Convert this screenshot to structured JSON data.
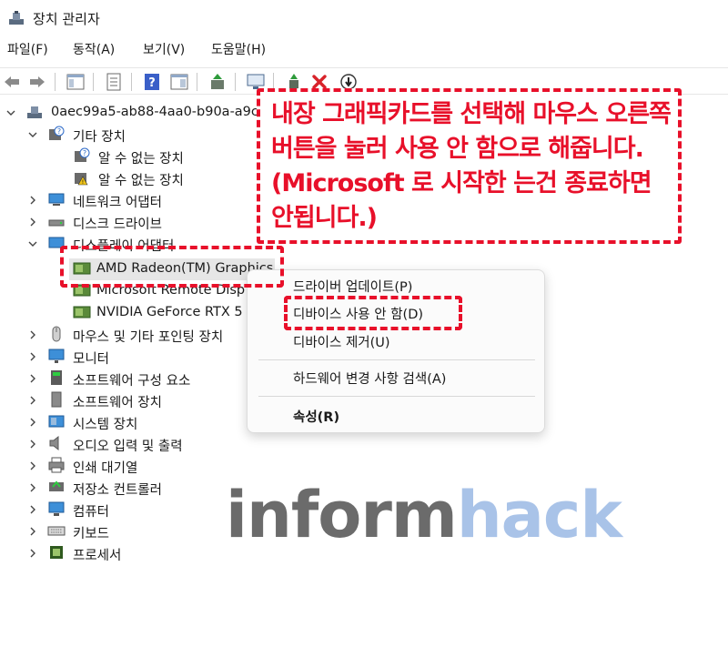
{
  "window": {
    "title": "장치 관리자"
  },
  "menu": [
    {
      "label": "파일(F)"
    },
    {
      "label": "동작(A)"
    },
    {
      "label": "보기(V)"
    },
    {
      "label": "도움말(H)"
    }
  ],
  "tree": {
    "root": "0aec99a5-ab88-4aa0-b90a-a9c",
    "other_devices": "기타 장치",
    "unknown_1": "알 수 없는 장치",
    "unknown_2": "알 수 없는 장치",
    "network": "네트워크 어댑터",
    "disk": "디스크 드라이브",
    "display": "디스플레이 어댑터",
    "amd": "AMD Radeon(TM) Graphics",
    "ms_remote": "Microsoft Remote Disp",
    "nvidia": "NVIDIA GeForce RTX 5",
    "mouse": "마우스 및 기타 포인팅 장치",
    "monitor": "모니터",
    "sw_component": "소프트웨어 구성 요소",
    "sw_device": "소프트웨어 장치",
    "system": "시스템 장치",
    "audio": "오디오 입력 및 출력",
    "print_queue": "인쇄 대기열",
    "storage": "저장소 컨트롤러",
    "computer": "컴퓨터",
    "keyboard": "키보드",
    "processor": "프로세서"
  },
  "context_menu": {
    "update_driver": "드라이버 업데이트(P)",
    "disable_device": "디바이스 사용 안 함(D)",
    "uninstall_device": "디바이스 제거(U)",
    "scan_hardware": "하드웨어 변경 사항 검색(A)",
    "properties": "속성(R)"
  },
  "callout": {
    "text": "내장 그래픽카드를 선택해 마우스 오른쪽 버튼을 눌러 사용 안 함으로 해줍니다. (Microsoft 로 시작한 는건 종료하면 안됩니다.)"
  },
  "watermark": {
    "part1": "inform",
    "part2": "hack"
  },
  "colors": {
    "highlight": "#e8102a",
    "watermark_gray": "#6b6b6b",
    "watermark_blue": "#a9c3e8"
  }
}
